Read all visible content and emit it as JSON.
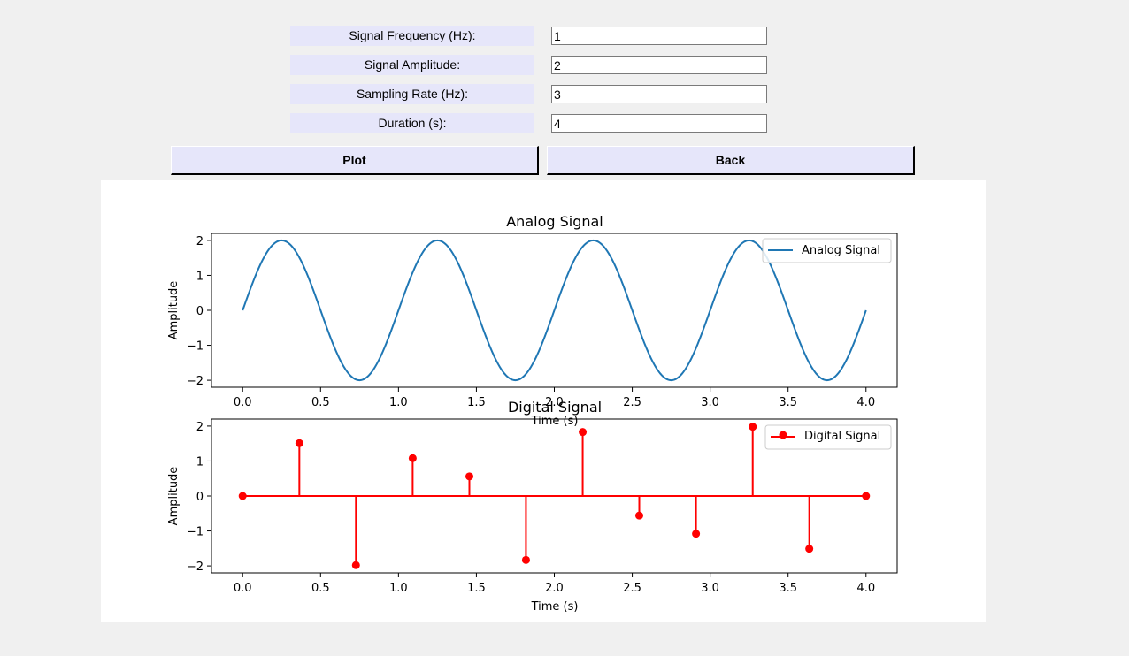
{
  "form": {
    "fields": [
      {
        "label": "Signal Frequency (Hz):",
        "value": "1"
      },
      {
        "label": "Signal Amplitude:",
        "value": "2"
      },
      {
        "label": "Sampling Rate (Hz):",
        "value": "3"
      },
      {
        "label": "Duration (s):",
        "value": "4"
      }
    ]
  },
  "buttons": {
    "plot": "Plot",
    "back": "Back"
  },
  "colors": {
    "analog_line": "#1f77b4",
    "digital": "#ff0000",
    "button_bg": "#e6e6fa",
    "label_bg": "#e6e6fa"
  },
  "chart_data": [
    {
      "type": "line",
      "title": "Analog Signal",
      "xlabel": "Time (s)",
      "ylabel": "Amplitude",
      "function": "2*sin(2*pi*1*t)",
      "frequency": 1,
      "amplitude": 2,
      "xlim": [
        -0.2,
        4.2
      ],
      "ylim": [
        -2.2,
        2.2
      ],
      "xticks": [
        "0.0",
        "0.5",
        "1.0",
        "1.5",
        "2.0",
        "2.5",
        "3.0",
        "3.5",
        "4.0"
      ],
      "yticks": [
        "2",
        "1",
        "0",
        "−1",
        "−2"
      ],
      "series": [
        {
          "name": "Analog Signal"
        }
      ],
      "legend": "upper right"
    },
    {
      "type": "stem",
      "title": "Digital Signal",
      "xlabel": "Time (s)",
      "ylabel": "Amplitude",
      "x": [
        0.0,
        0.364,
        0.727,
        1.091,
        1.455,
        1.818,
        2.182,
        2.545,
        2.909,
        3.273,
        3.636,
        4.0
      ],
      "values": [
        0.0,
        1.51,
        -1.98,
        1.08,
        0.56,
        -1.83,
        1.83,
        -0.56,
        -1.08,
        1.98,
        -1.51,
        0.0
      ],
      "xlim": [
        -0.2,
        4.2
      ],
      "ylim": [
        -2.2,
        2.2
      ],
      "xticks": [
        "0.0",
        "0.5",
        "1.0",
        "1.5",
        "2.0",
        "2.5",
        "3.0",
        "3.5",
        "4.0"
      ],
      "yticks": [
        "2",
        "1",
        "0",
        "−1",
        "−2"
      ],
      "series": [
        {
          "name": "Digital Signal"
        }
      ],
      "legend": "upper right"
    }
  ]
}
